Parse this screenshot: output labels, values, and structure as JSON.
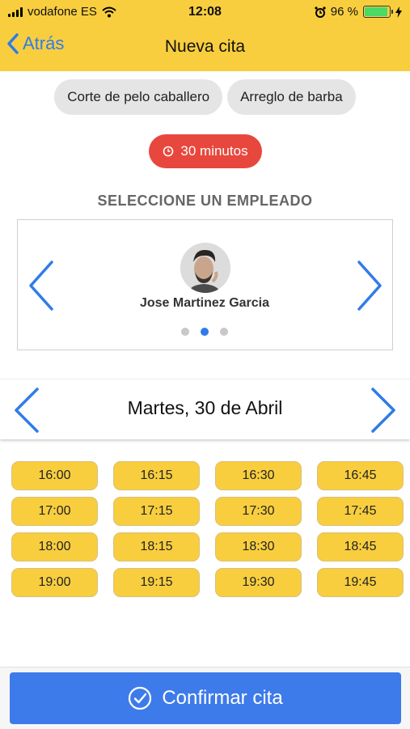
{
  "status": {
    "carrier": "vodafone ES",
    "time": "12:08",
    "battery": "96 %",
    "battery_level": 0.96
  },
  "nav": {
    "back_label": "Atrás",
    "title": "Nueva cita"
  },
  "services": [
    {
      "label": "Corte de pelo caballero"
    },
    {
      "label": "Arreglo de barba"
    }
  ],
  "duration": {
    "label": "30 minutos"
  },
  "employee_section": {
    "label": "SELECCIONE UN EMPLEADO",
    "employee_name": "Jose Martinez Garcia",
    "page_count": 3,
    "active_page": 1
  },
  "date": {
    "label": "Martes, 30 de Abril"
  },
  "slots": [
    "16:00",
    "16:15",
    "16:30",
    "16:45",
    "17:00",
    "17:15",
    "17:30",
    "17:45",
    "18:00",
    "18:15",
    "18:30",
    "18:45",
    "19:00",
    "19:15",
    "19:30",
    "19:45"
  ],
  "confirm": {
    "label": "Confirmar cita"
  },
  "colors": {
    "header": "#f8ce3f",
    "accent_blue": "#3d7bea",
    "duration_red": "#e8473d",
    "slot_yellow": "#f8ce3f"
  }
}
